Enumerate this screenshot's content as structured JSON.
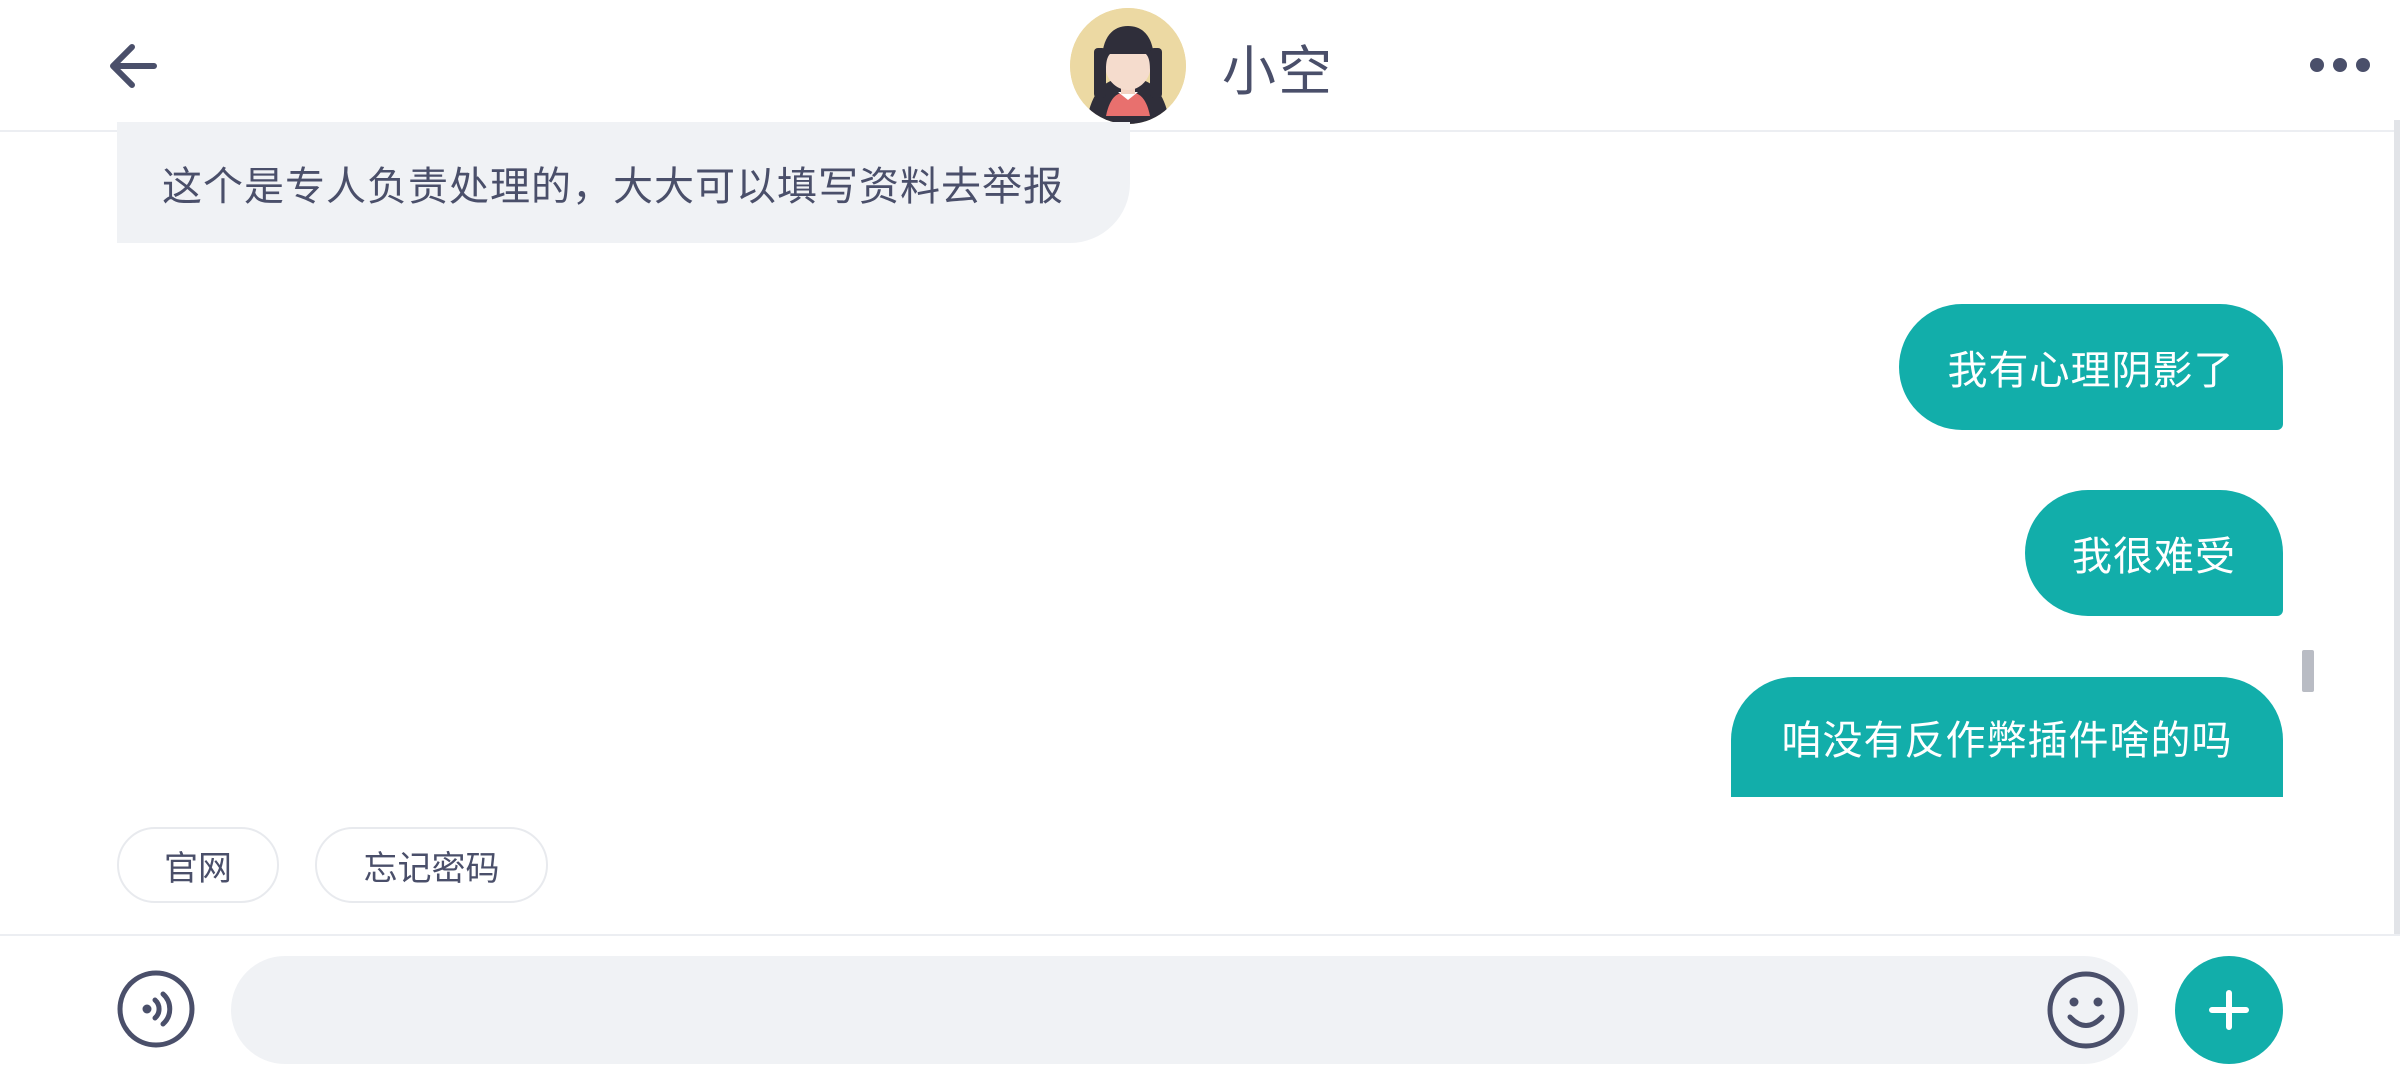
{
  "header": {
    "title": "小空",
    "back_icon": "arrow-left-icon",
    "more_icon": "more-horizontal-icon",
    "avatar": "girl-avatar"
  },
  "messages": [
    {
      "direction": "incoming",
      "text": "这个是专人负责处理的，大大可以填写资料去举报"
    },
    {
      "direction": "outgoing",
      "text": "我有心理阴影了"
    },
    {
      "direction": "outgoing",
      "text": "我很难受"
    },
    {
      "direction": "outgoing",
      "text": "咱没有反作弊插件啥的吗"
    }
  ],
  "quick_replies": [
    "官网",
    "忘记密码"
  ],
  "input_bar": {
    "voice_icon": "voice-icon",
    "placeholder": "",
    "emoji_icon": "smiley-icon",
    "plus_icon": "plus-icon"
  },
  "colors": {
    "accent": "#12aeaa",
    "text": "#4a4f6a",
    "incoming_bubble": "#f0f2f5"
  }
}
